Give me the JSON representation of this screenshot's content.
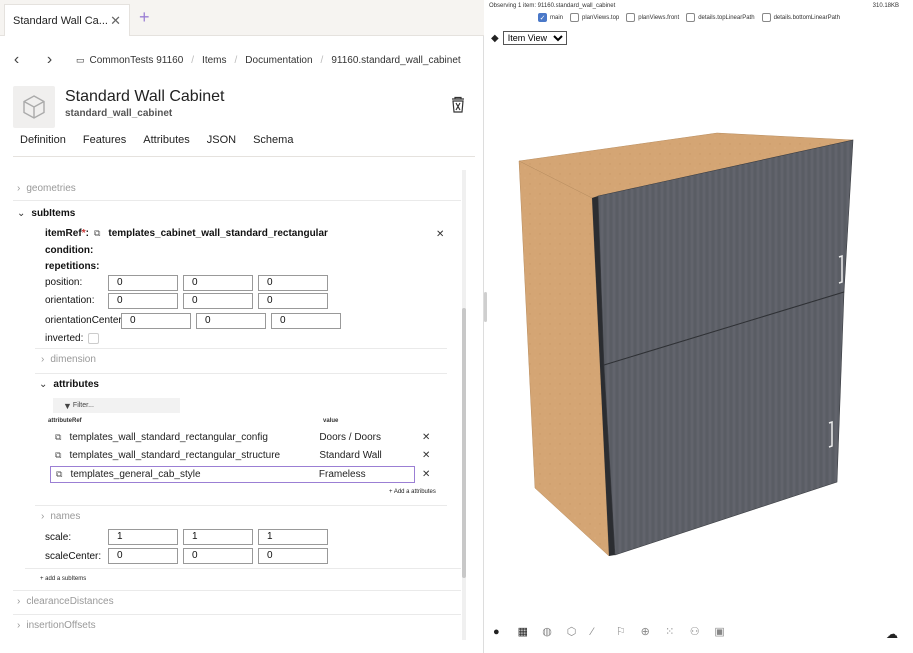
{
  "tabs": [
    {
      "label": "Standard Wall Ca..."
    }
  ],
  "breadcrumb": [
    "CommonTests 91160",
    "Items",
    "Documentation",
    "91160.standard_wall_cabinet"
  ],
  "header": {
    "title": "Standard Wall Cabinet",
    "subtitle": "standard_wall_cabinet"
  },
  "page_tabs": [
    "Definition",
    "Features",
    "Attributes",
    "JSON",
    "Schema"
  ],
  "tree": {
    "geometries": "geometries",
    "subItems": "subItems",
    "itemRef_label": "itemRef",
    "itemRef_required": "*",
    "itemRef_value": "templates_cabinet_wall_standard_rectangular",
    "condition": "condition:",
    "repetitions": "repetitions:",
    "position_label": "position:",
    "position": [
      "0",
      "0",
      "0"
    ],
    "orientation_label": "orientation:",
    "orientation": [
      "0",
      "0",
      "0"
    ],
    "orientationCenter_label": "orientationCenter:",
    "orientationCenter": [
      "0",
      "0",
      "0"
    ],
    "inverted_label": "inverted:",
    "dimension": "dimension",
    "attributes": "attributes",
    "filter_placeholder": "Filter...",
    "col_attrRef": "attributeRef",
    "col_value": "value",
    "attr_rows": [
      {
        "ref": "templates_wall_standard_rectangular_config",
        "value": "Doors / Doors"
      },
      {
        "ref": "templates_wall_standard_rectangular_structure",
        "value": "Standard Wall"
      },
      {
        "ref": "templates_general_cab_style",
        "value": "Frameless"
      }
    ],
    "add_attributes": "+ Add a attributes",
    "names": "names",
    "scale_label": "scale:",
    "scale": [
      "1",
      "1",
      "1"
    ],
    "scaleCenter_label": "scaleCenter:",
    "scaleCenter": [
      "0",
      "0",
      "0"
    ],
    "add_subitems": "+ add a subItems",
    "clearanceDistances": "clearanceDistances",
    "insertionOffsets": "insertionOffsets"
  },
  "viewer": {
    "observing": "Observing 1 item: 91160.standard_wall_cabinet",
    "size": "310.18KB",
    "views": [
      {
        "label": "main",
        "checked": true
      },
      {
        "label": "planViews.top",
        "checked": false
      },
      {
        "label": "planViews.front",
        "checked": false
      },
      {
        "label": "details.topLinearPath",
        "checked": false
      },
      {
        "label": "details.bottomLinearPath",
        "checked": false
      }
    ],
    "view_select": "Item View",
    "colors": {
      "body": "#d4a574",
      "doors": "#5d6068",
      "handle": "#eeeeee"
    }
  }
}
